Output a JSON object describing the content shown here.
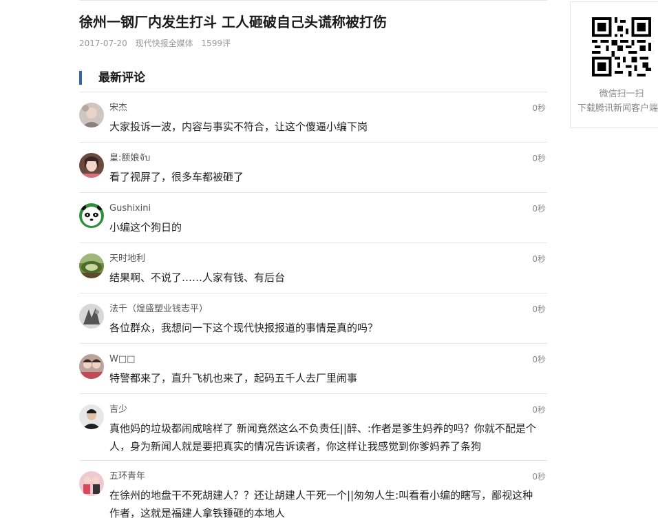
{
  "article": {
    "title": "徐州一钢厂内发生打斗 工人砸破自己头谎称被打伤",
    "date": "2017-07-20",
    "source": "现代快报全媒体",
    "comment_count": "1599评"
  },
  "section": {
    "title": "最新评论"
  },
  "comments": [
    {
      "nick": "宋杰",
      "time": "0秒",
      "text": "大家投诉一波，内容与事实不符合，让这个傻逼小编下岗",
      "avatar": "avatar-photo"
    },
    {
      "nick": "皇:额娘จับ",
      "time": "0秒",
      "text": "看了视屏了，很多车都被砸了",
      "avatar": "avatar-photo"
    },
    {
      "nick": "Gushixini",
      "time": "0秒",
      "text": "小编这个狗日的",
      "avatar": "panda-avatar"
    },
    {
      "nick": "天时地利",
      "time": "0秒",
      "text": "结果啊、不说了……人家有钱、有后台",
      "avatar": "avatar-photo"
    },
    {
      "nick": "法千（煌盛塑业钱志平）",
      "time": "0秒",
      "text": "各位群众，我想问一下这个现代快报报道的事情是真的吗？",
      "avatar": "avatar-photo"
    },
    {
      "nick": "W□□",
      "time": "0秒",
      "text": "特警都来了，直升飞机也来了，起码五千人去厂里闹事",
      "avatar": "avatar-photo"
    },
    {
      "nick": "吉少",
      "time": "0秒",
      "text": "真他妈的垃圾都闹成啥样了 新闻竟然这么不负责任||醉、:作者是爹生妈养的吗？你就不配是个人，身为新闻人就是要把真实的情况告诉读者，你这样让我感觉到你爹妈养了条狗",
      "avatar": "avatar-photo"
    },
    {
      "nick": "五环青年",
      "time": "0秒",
      "text": "在徐州的地盘干不死胡建人？？还让胡建人干死一个||匆匆人生:叫看看小编的瞎写，鄙视这种作者，这就是福建人拿铁锤砸的本地人",
      "avatar": "avatar-photo"
    }
  ],
  "qr_panel": {
    "line1": "微信扫一扫",
    "line2": "下载腾讯新闻客户端"
  }
}
